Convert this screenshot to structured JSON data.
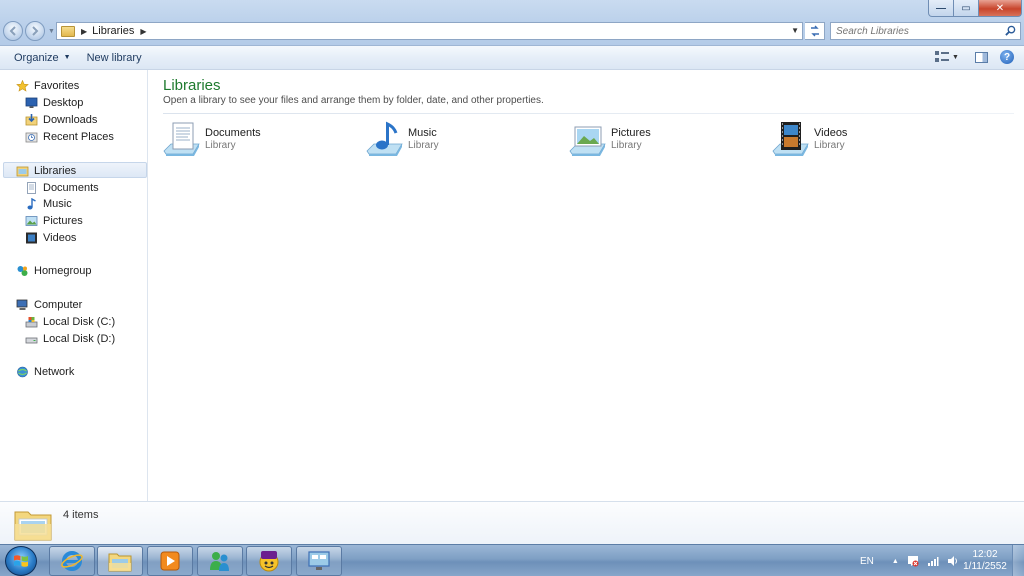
{
  "window": {
    "controls": {
      "minimize": "—",
      "maximize": "▭",
      "close": "✕"
    }
  },
  "address_bar": {
    "breadcrumb": [
      "Libraries"
    ],
    "search_placeholder": "Search Libraries"
  },
  "toolbar": {
    "organize_label": "Organize",
    "new_library_label": "New library"
  },
  "nav_pane": {
    "favorites": {
      "label": "Favorites",
      "items": [
        "Desktop",
        "Downloads",
        "Recent Places"
      ]
    },
    "libraries": {
      "label": "Libraries",
      "items": [
        "Documents",
        "Music",
        "Pictures",
        "Videos"
      ]
    },
    "homegroup": {
      "label": "Homegroup"
    },
    "computer": {
      "label": "Computer",
      "items": [
        "Local Disk (C:)",
        "Local Disk (D:)"
      ]
    },
    "network": {
      "label": "Network"
    }
  },
  "content": {
    "title": "Libraries",
    "description": "Open a library to see your files and arrange them by folder, date, and other properties.",
    "libraries": [
      {
        "name": "Documents",
        "type": "Library",
        "icon": "documents-library-icon"
      },
      {
        "name": "Music",
        "type": "Library",
        "icon": "music-library-icon"
      },
      {
        "name": "Pictures",
        "type": "Library",
        "icon": "pictures-library-icon"
      },
      {
        "name": "Videos",
        "type": "Library",
        "icon": "videos-library-icon"
      }
    ]
  },
  "details_pane": {
    "item_count": "4 items"
  },
  "taskbar": {
    "pinned": [
      "internet-explorer-icon",
      "windows-explorer-icon",
      "media-player-icon",
      "messenger-icon",
      "yahoo-messenger-icon",
      "remote-desktop-icon"
    ],
    "tray": {
      "language": "EN",
      "time": "12:02",
      "date": "1/11/2552"
    }
  },
  "colors": {
    "title_green": "#1e7a2e",
    "titlebar_blue": "#b9cfea",
    "taskbar_blue": "#7e9fc4",
    "close_red": "#c8452c"
  }
}
